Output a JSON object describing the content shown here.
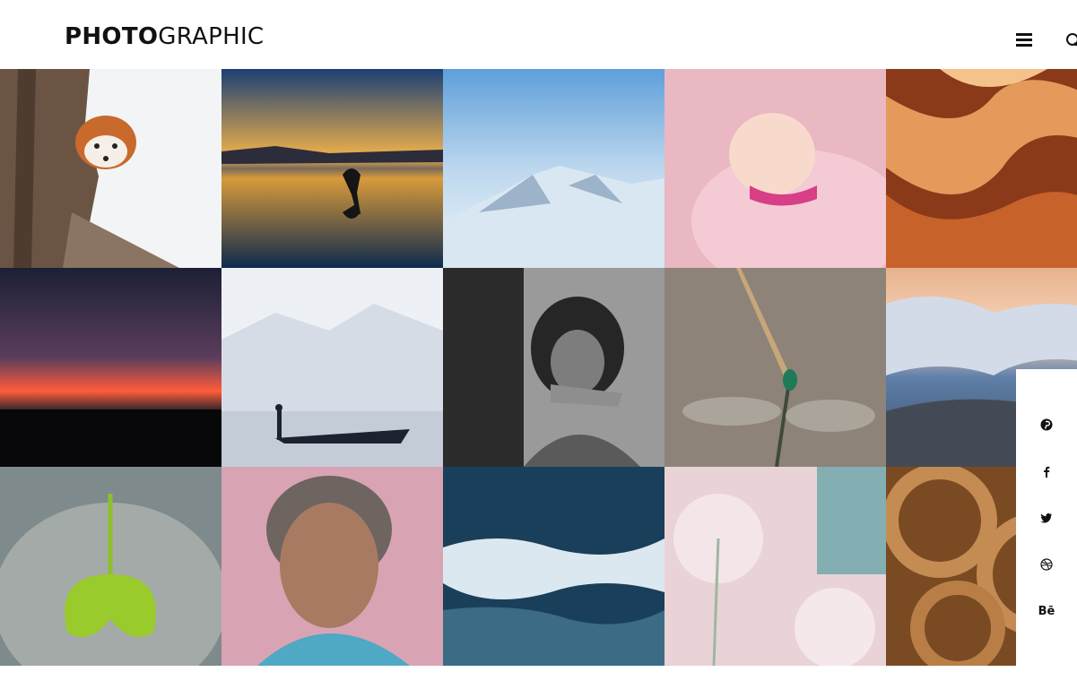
{
  "brand": {
    "bold": "PHOTO",
    "light": "GRAPHIC"
  },
  "header": {
    "menu_icon": "hamburger-menu-icon",
    "search_icon": "search-icon"
  },
  "gallery": [
    {
      "name": "red-panda",
      "colors": [
        "#f4f4f6",
        "#6a5444"
      ]
    },
    {
      "name": "yoga-sunset-lake",
      "colors": [
        "#0f2f5a",
        "#f0a030"
      ]
    },
    {
      "name": "snowy-mountains",
      "colors": [
        "#6ca3d9",
        "#e8f0f8"
      ]
    },
    {
      "name": "pink-flamingo",
      "colors": [
        "#e8b7c0",
        "#f7d7dc"
      ]
    },
    {
      "name": "sandstone-canyon",
      "colors": [
        "#8a3a15",
        "#e39a5b"
      ]
    },
    {
      "name": "starry-dusk-sky",
      "colors": [
        "#1d2238",
        "#ff5c3a"
      ]
    },
    {
      "name": "misty-fisherman",
      "colors": [
        "#e8ecf2",
        "#1c2230"
      ]
    },
    {
      "name": "girl-portrait-bw",
      "colors": [
        "#2a2a2a",
        "#9a9a9a"
      ]
    },
    {
      "name": "dragonfly",
      "colors": [
        "#8d8378",
        "#c7a77a"
      ]
    },
    {
      "name": "sea-of-clouds",
      "colors": [
        "#e9b18a",
        "#5f7fa8"
      ]
    },
    {
      "name": "buddha-ginkgo-leaf",
      "colors": [
        "#7c8a8a",
        "#9acb2c"
      ]
    },
    {
      "name": "elderly-woman-portrait",
      "colors": [
        "#d8a4b4",
        "#5a4038"
      ]
    },
    {
      "name": "ocean-waves",
      "colors": [
        "#1d4460",
        "#e6f0f5"
      ]
    },
    {
      "name": "dandelion-flowers",
      "colors": [
        "#e9d3d6",
        "#6aa6a9"
      ]
    },
    {
      "name": "coiled-rope",
      "colors": [
        "#7a4a22",
        "#c48b52"
      ]
    }
  ],
  "social": [
    {
      "name": "pinterest-icon",
      "label": ""
    },
    {
      "name": "facebook-icon",
      "label": ""
    },
    {
      "name": "twitter-icon",
      "label": ""
    },
    {
      "name": "dribbble-icon",
      "label": ""
    },
    {
      "name": "behance-icon",
      "label": "Bē"
    }
  ]
}
